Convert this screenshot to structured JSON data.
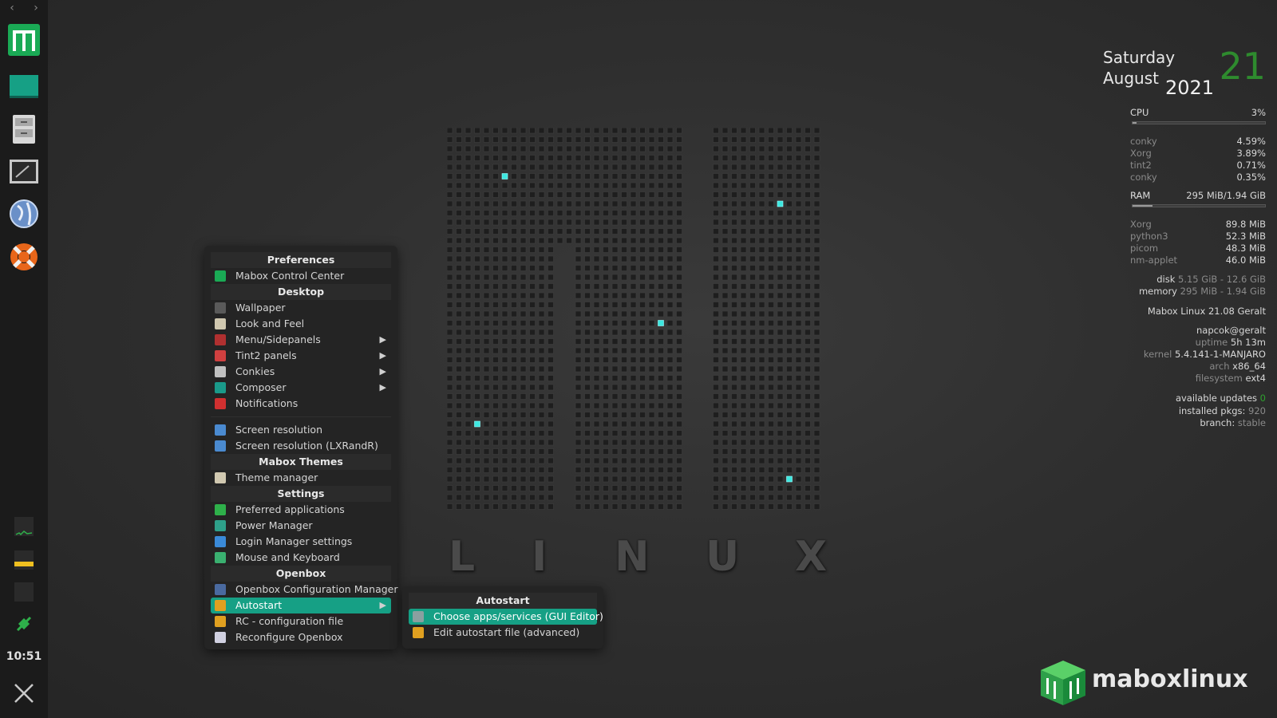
{
  "panel": {
    "nav_prev": "‹",
    "nav_next": "›",
    "launchers": [
      "mabox-menu-icon",
      "desktop-icon",
      "file-manager-icon",
      "terminal-icon",
      "web-browser-icon",
      "help-icon"
    ],
    "clock": "10:51"
  },
  "wallpaper": {
    "letters": [
      "L",
      "I",
      "N",
      "U",
      "X"
    ],
    "accent": "#3de8e0"
  },
  "main_menu": {
    "sections": [
      {
        "header": "Preferences",
        "items": [
          {
            "label": "Mabox Control Center",
            "icon": "mabox-control-icon",
            "color": "#1aaa55",
            "submenu": false
          }
        ]
      },
      {
        "header": "Desktop",
        "items": [
          {
            "label": "Wallpaper",
            "icon": "wallpaper-icon",
            "color": "#5a5a5a",
            "submenu": false
          },
          {
            "label": "Look and Feel",
            "icon": "look-feel-icon",
            "color": "#d0c8b0",
            "submenu": false
          },
          {
            "label": "Menu/Sidepanels",
            "icon": "menu-sidepanels-icon",
            "color": "#b03030",
            "submenu": true
          },
          {
            "label": "Tint2 panels",
            "icon": "tint2-icon",
            "color": "#d04040",
            "submenu": true
          },
          {
            "label": "Conkies",
            "icon": "conkies-icon",
            "color": "#c0c0c0",
            "submenu": true
          },
          {
            "label": "Composer",
            "icon": "composer-icon",
            "color": "#1a9a8a",
            "submenu": true
          },
          {
            "label": "Notifications",
            "icon": "notifications-icon",
            "color": "#d03030",
            "submenu": false
          }
        ]
      },
      {
        "header": "",
        "items": [
          {
            "label": "Screen resolution",
            "icon": "screen-resolution-icon",
            "color": "#4a8ad0",
            "submenu": false
          },
          {
            "label": "Screen resolution (LXRandR)",
            "icon": "lxrandr-icon",
            "color": "#4a8ad0",
            "submenu": false
          }
        ]
      },
      {
        "header": "Mabox Themes",
        "items": [
          {
            "label": "Theme manager",
            "icon": "theme-manager-icon",
            "color": "#d0c8b0",
            "submenu": false
          }
        ]
      },
      {
        "header": "Settings",
        "items": [
          {
            "label": "Preferred applications",
            "icon": "preferred-apps-icon",
            "color": "#2eb04a",
            "submenu": false
          },
          {
            "label": "Power Manager",
            "icon": "power-manager-icon",
            "color": "#2ea08a",
            "submenu": false
          },
          {
            "label": "Login Manager settings",
            "icon": "login-manager-icon",
            "color": "#3a8ad8",
            "submenu": false
          },
          {
            "label": "Mouse and Keyboard",
            "icon": "mouse-keyboard-icon",
            "color": "#3ab070",
            "submenu": false
          }
        ]
      },
      {
        "header": "Openbox",
        "items": [
          {
            "label": "Openbox Configuration Manager",
            "icon": "obconf-icon",
            "color": "#4a6aa0",
            "submenu": false
          },
          {
            "label": "Autostart",
            "icon": "autostart-icon",
            "color": "#e0a020",
            "submenu": true,
            "active": true
          },
          {
            "label": "RC - configuration file",
            "icon": "rc-file-icon",
            "color": "#e0a020",
            "submenu": false
          },
          {
            "label": "Reconfigure Openbox",
            "icon": "reconfigure-icon",
            "color": "#d0d0e0",
            "submenu": false
          }
        ]
      }
    ]
  },
  "sub_menu": {
    "header": "Autostart",
    "items": [
      {
        "label": "Choose apps/services (GUI Editor)",
        "icon": "gui-editor-icon",
        "color": "#8aa0a0",
        "active": true
      },
      {
        "label": "Edit autostart file (advanced)",
        "icon": "edit-autostart-icon",
        "color": "#e0a020",
        "active": false
      }
    ]
  },
  "conky": {
    "day": "Saturday",
    "month": "August",
    "year": "2021",
    "date": "21",
    "cpu": {
      "label": "CPU",
      "value": "3%",
      "fraction": 0.03
    },
    "cpu_procs": [
      {
        "name": "conky",
        "value": "4.59%"
      },
      {
        "name": "Xorg",
        "value": "3.89%"
      },
      {
        "name": "tint2",
        "value": "0.71%"
      },
      {
        "name": "conky",
        "value": "0.35%"
      }
    ],
    "ram": {
      "label": "RAM",
      "value": "295 MiB/1.94 GiB",
      "fraction": 0.15
    },
    "ram_procs": [
      {
        "name": "Xorg",
        "value": "89.8 MiB"
      },
      {
        "name": "python3",
        "value": "52.3 MiB"
      },
      {
        "name": "picom",
        "value": "48.3 MiB"
      },
      {
        "name": "nm-applet",
        "value": "46.0 MiB"
      }
    ],
    "disk_label": "disk",
    "disk_value": "5.15 GiB - 12.6 GiB",
    "memory_label": "memory",
    "memory_value": "295 MiB - 1.94 GiB",
    "distro": "Mabox Linux 21.08 Geralt",
    "user": "napcok@geralt",
    "uptime_label": "uptime",
    "uptime_value": "5h 13m",
    "kernel_label": "kernel",
    "kernel_value": "5.4.141-1-MANJARO",
    "arch_label": "arch",
    "arch_value": "x86_64",
    "fs_label": "filesystem",
    "fs_value": "ext4",
    "updates_label": "available updates",
    "updates_value": "0",
    "pkgs_label": "installed pkgs:",
    "pkgs_value": "920",
    "branch_label": "branch:",
    "branch_value": "stable"
  },
  "logo": {
    "text": "maboxlinux"
  }
}
